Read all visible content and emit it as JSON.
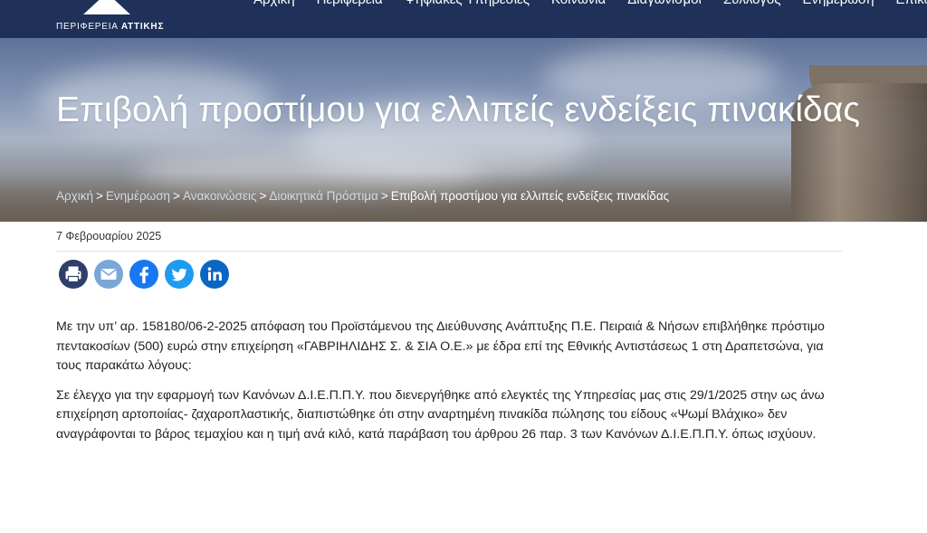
{
  "header": {
    "logo_text_prefix": "ΠΕΡΙΦΕΡΕΙΑ",
    "logo_text_bold": "ΑΤΤΙΚΗΣ",
    "nav": [
      "Αρχική",
      "Περιφέρεια",
      "Ψηφιακές Υπηρεσίες",
      "Κοινωνία",
      "Διαγωνισμοί",
      "Σύλλογος",
      "Ενημέρωση",
      "Επικοινωνία"
    ]
  },
  "hero": {
    "title": "Επιβολή προστίμου για ελλιπείς ενδείξεις πινακίδας",
    "breadcrumb": {
      "items": [
        "Αρχική",
        "Ενημέρωση",
        "Ανακοινώσεις",
        "Διοικητικά Πρόστιμα"
      ],
      "separator": ">",
      "current": "Επιβολή προστίμου για ελλιπείς ενδείξεις πινακίδας"
    }
  },
  "article": {
    "date": "7 Φεβρουαρίου 2025",
    "share_icons": [
      "print-icon",
      "email-icon",
      "facebook-icon",
      "twitter-icon",
      "linkedin-icon"
    ],
    "paragraphs": [
      "Με την υπ’ αρ. 158180/06-2-2025 απόφαση του Προϊστάμενου της Διεύθυνσης Ανάπτυξης Π.Ε. Πειραιά & Νήσων επιβλήθηκε πρόστιμο πεντακοσίων (500) ευρώ στην επιχείρηση «ΓΑΒΡΙΗΛΙΔΗΣ Σ. & ΣΙΑ Ο.Ε.» με έδρα επί της Εθνικής Αντιστάσεως 1 στη Δραπετσώνα, για τους παρακάτω λόγους:",
      "Σε έλεγχο για την εφαρμογή των Κανόνων Δ.Ι.Ε.Π.Π.Υ. που διενεργήθηκε από ελεγκτές της Υπηρεσίας μας στις 29/1/2025 στην ως άνω επιχείρηση αρτοποιίας- ζαχαροπλαστικής, διαπιστώθηκε ότι στην αναρτημένη πινακίδα πώλησης του είδους «Ψωμί Βλάχικο» δεν αναγράφονται το βάρος τεμαχίου και η τιμή ανά κιλό, κατά παράβαση του άρθρου 26 παρ. 3 των Κανόνων Δ.Ι.Ε.Π.Π.Υ. όπως ισχύουν."
    ]
  },
  "colors": {
    "topbar": "#1f3158",
    "hero_title": "#ffffff",
    "print": "#2f3f6b",
    "email": "#7aa6d8",
    "facebook": "#1877f2",
    "twitter": "#1d9bf0",
    "linkedin": "#0a66c2"
  }
}
